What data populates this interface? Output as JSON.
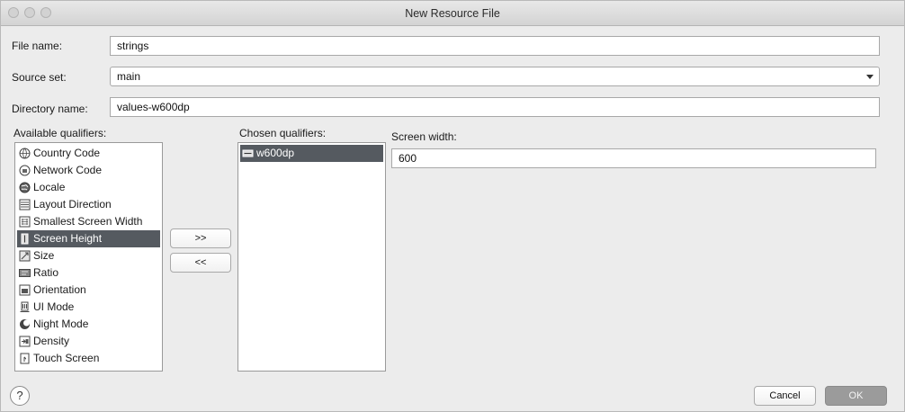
{
  "window": {
    "title": "New Resource File"
  },
  "form": {
    "file_name_label": "File name:",
    "file_name_value": "strings",
    "source_set_label": "Source set:",
    "source_set_value": "main",
    "directory_name_label": "Directory name:",
    "directory_name_value": "values-w600dp"
  },
  "available": {
    "label": "Available qualifiers:",
    "items": [
      {
        "label": "Country Code",
        "icon": "globe-icon"
      },
      {
        "label": "Network Code",
        "icon": "network-icon"
      },
      {
        "label": "Locale",
        "icon": "locale-icon"
      },
      {
        "label": "Layout Direction",
        "icon": "layout-direction-icon"
      },
      {
        "label": "Smallest Screen Width",
        "icon": "smallest-screen-width-icon"
      },
      {
        "label": "Screen Height",
        "icon": "screen-height-icon",
        "selected": true
      },
      {
        "label": "Size",
        "icon": "size-icon"
      },
      {
        "label": "Ratio",
        "icon": "ratio-icon"
      },
      {
        "label": "Orientation",
        "icon": "orientation-icon"
      },
      {
        "label": "UI Mode",
        "icon": "ui-mode-icon"
      },
      {
        "label": "Night Mode",
        "icon": "night-mode-icon"
      },
      {
        "label": "Density",
        "icon": "density-icon"
      },
      {
        "label": "Touch Screen",
        "icon": "touch-screen-icon"
      }
    ]
  },
  "transfer": {
    "add_label": ">>",
    "remove_label": "<<"
  },
  "chosen": {
    "label": "Chosen qualifiers:",
    "items": [
      {
        "label": "w600dp",
        "icon": "screen-width-icon",
        "selected": true
      }
    ]
  },
  "detail": {
    "screen_width_label": "Screen width:",
    "screen_width_value": "600"
  },
  "footer": {
    "help_label": "?",
    "cancel_label": "Cancel",
    "ok_label": "OK"
  }
}
